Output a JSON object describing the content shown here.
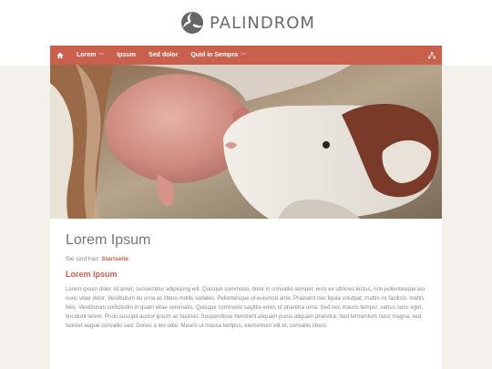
{
  "site": {
    "name": "PALINDROM"
  },
  "nav": {
    "items": [
      {
        "label": "Lorem",
        "dropdown": true
      },
      {
        "label": "Ipsum",
        "dropdown": false
      },
      {
        "label": "Sed dolor",
        "dropdown": false
      },
      {
        "label": "Quid in Sempra",
        "dropdown": true
      }
    ],
    "home_icon": "home-icon",
    "right_icon": "sitemap-icon"
  },
  "hero": {
    "image": "calf-nursing-from-cow-photo"
  },
  "page": {
    "title": "Lorem Ipsum",
    "breadcrumb_prefix": "Sie sind hier:",
    "breadcrumb_link": "Startseite",
    "subheading": "Lorem Ipsum",
    "body": "Lorem ipsum dolor sit amet, consectetur adipiscing elit. Quisque commodo, dolor in convallis semper, eros ex ultricies lectus, non pellentesque leo nunc vitae dolor. Vestibulum eu urna ac libero mollis sodales. Pellentesque ut euismod ante. Praesent nec ligula volutpat, mattis mi facilisis, mattis felis. Vestibulum sollicitudin in quam vitae venenatis. Quisque commodo sagittis enim, id pharetra urna. Sed nec mauris tempor, varius nunc eget, tincidunt lorem. Proin suscipit auctor ipsum ac facilisis. Suspendisse hendrerit aliquam purus aliquam pharetra. Sed fermentum nunc magna, sed laoreet augue convallis sed. Donec a leo odio. Mauris ut massa tempus, elementum elit et, convallis libero."
  },
  "colors": {
    "accent": "#c8604d",
    "background": "#f4f1ec",
    "text": "#888888",
    "title": "#777777"
  }
}
